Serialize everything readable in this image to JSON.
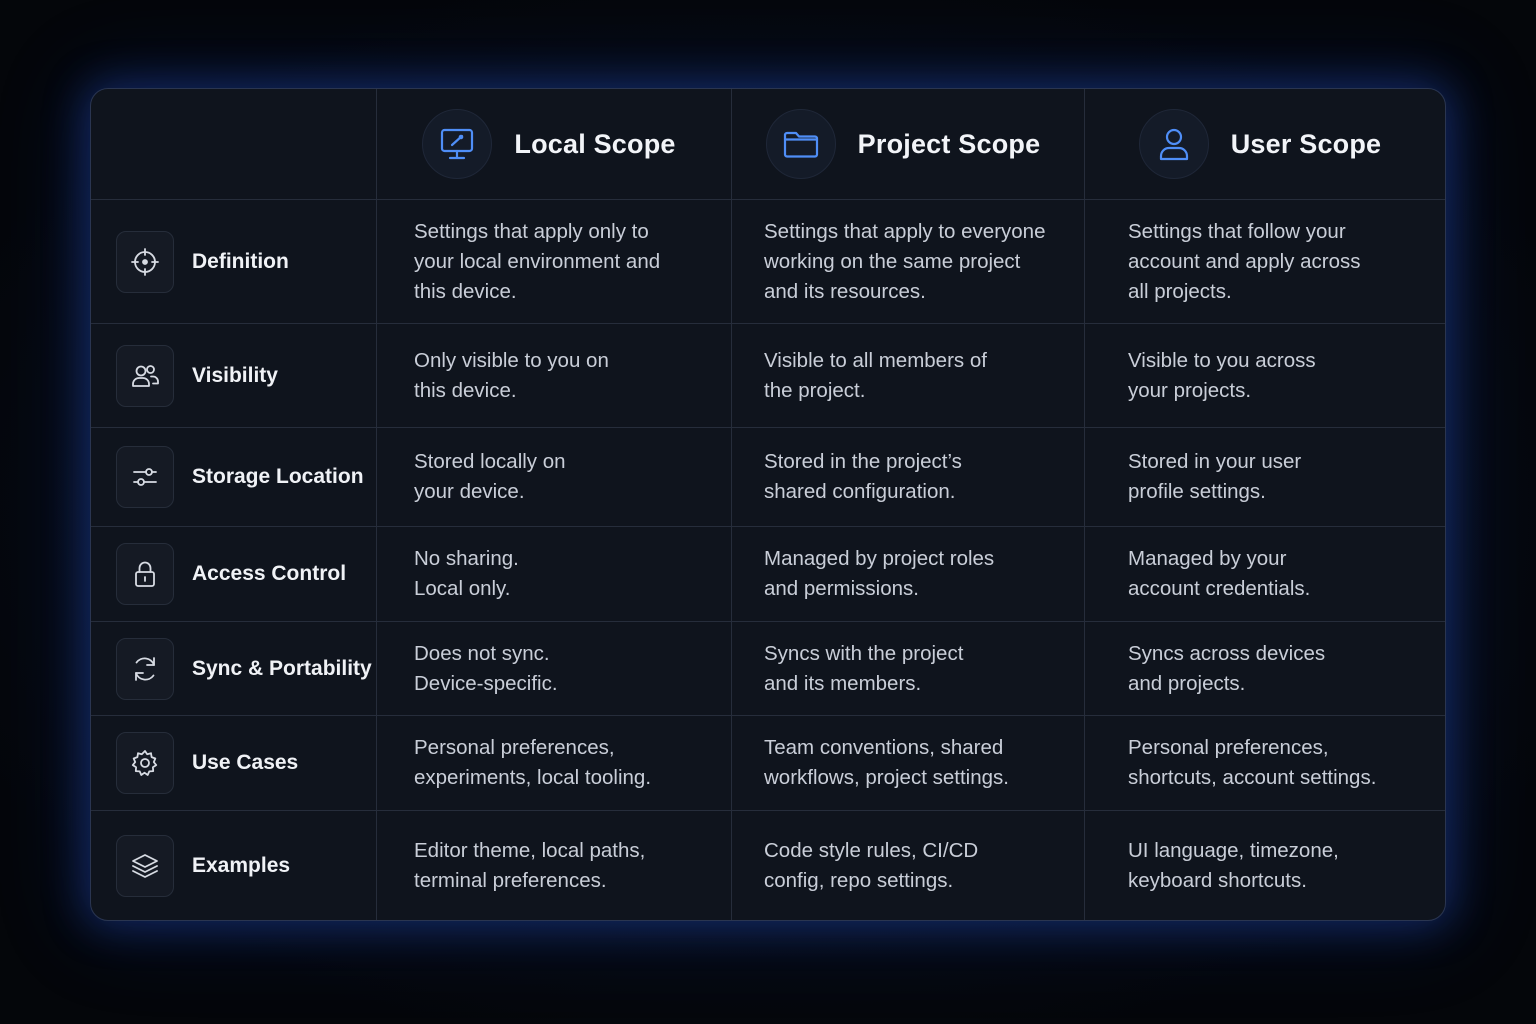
{
  "columns": [
    {
      "title": "Local Scope",
      "icon": "monitor-icon"
    },
    {
      "title": "Project Scope",
      "icon": "folder-icon"
    },
    {
      "title": "User Scope",
      "icon": "user-icon"
    }
  ],
  "rows": [
    {
      "label": "Definition",
      "icon": "crosshair-icon",
      "cells": [
        [
          "Settings that apply only to",
          "your local environment and",
          "this device."
        ],
        [
          "Settings that apply to everyone",
          "working on the same project",
          "and its resources."
        ],
        [
          "Settings that follow your",
          "account and apply across",
          "all projects."
        ]
      ]
    },
    {
      "label": "Visibility",
      "icon": "users-icon",
      "cells": [
        [
          "Only visible to you on",
          "this device."
        ],
        [
          "Visible to all members of",
          "the project."
        ],
        [
          "Visible to you across",
          "your projects."
        ]
      ]
    },
    {
      "label": "Storage Location",
      "icon": "sliders-icon",
      "cells": [
        [
          "Stored locally on",
          "your device."
        ],
        [
          "Stored in the project’s",
          "shared configuration."
        ],
        [
          "Stored in your user",
          "profile settings."
        ]
      ]
    },
    {
      "label": "Access Control",
      "icon": "lock-icon",
      "cells": [
        [
          "No sharing.",
          "Local only."
        ],
        [
          "Managed by project roles",
          "and permissions."
        ],
        [
          "Managed by your",
          "account credentials."
        ]
      ]
    },
    {
      "label": "Sync & Portability",
      "icon": "refresh-icon",
      "cells": [
        [
          "Does not sync.",
          "Device-specific."
        ],
        [
          "Syncs with the project",
          "and its members."
        ],
        [
          "Syncs across devices",
          "and projects."
        ]
      ]
    },
    {
      "label": "Use Cases",
      "icon": "gear-icon",
      "cells": [
        [
          "Personal preferences,",
          "experiments, local tooling."
        ],
        [
          "Team conventions, shared",
          "workflows, project settings."
        ],
        [
          "Personal preferences,",
          "shortcuts, account settings."
        ]
      ]
    },
    {
      "label": "Examples",
      "icon": "layers-icon",
      "cells": [
        [
          "Editor theme, local paths,",
          "terminal preferences."
        ],
        [
          "Code style rules, CI/CD",
          "config, repo settings."
        ],
        [
          "UI language, timezone,",
          "keyboard shortcuts."
        ]
      ]
    }
  ],
  "colors": {
    "accent_icon": "#4f8ef7",
    "row_icon": "#d7dbe3"
  }
}
